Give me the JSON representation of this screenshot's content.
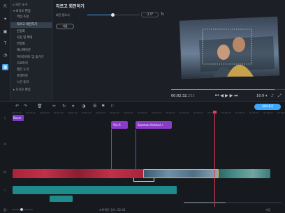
{
  "sidebar": {
    "icons": [
      "import-icon",
      "wand-icon",
      "filters-icon",
      "text-icon",
      "stickers-icon",
      "transitions-icon"
    ]
  },
  "panel": {
    "items": [
      {
        "label": "모든 도구",
        "level": 0
      },
      {
        "label": "▾ 비디오 편집",
        "level": 1
      },
      {
        "label": "색상 조정",
        "level": 2
      },
      {
        "label": "자르고 회전하기",
        "level": 2,
        "selected": true
      },
      {
        "label": "안정화",
        "level": 2
      },
      {
        "label": "자동 및 확대",
        "level": 2
      },
      {
        "label": "변형화",
        "level": 2
      },
      {
        "label": "애니메이션",
        "level": 2
      },
      {
        "label": "하이라이트 및 숨기기",
        "level": 2
      },
      {
        "label": "크로마키",
        "level": 2
      },
      {
        "label": "팬은 도리",
        "level": 2
      },
      {
        "label": "프레이밍",
        "level": 2
      },
      {
        "label": "느린 동작",
        "level": 2
      },
      {
        "label": "▸ 오디오 편집",
        "level": 1
      }
    ]
  },
  "tools": {
    "title": "자르고 회전하기",
    "angle_label": "회전 정도기",
    "angle_value": "-2.5°",
    "crop_button": "자름"
  },
  "preview": {
    "timecode": "00:02:32",
    "timecode_frac": ".253",
    "aspect": "16:9 ▾"
  },
  "timeline": {
    "export_button": "내보내기",
    "ruler": [
      "00:00:00",
      "00:00:20",
      "00:00:40",
      "00:01:00",
      "00:01:20",
      "00:01:40",
      "00:02:00",
      "00:02:20",
      "00:02:40",
      "00:03:00",
      "00:03:20",
      "00:03:40",
      "00:04:00",
      "00:04:20",
      "00:04:40",
      "00:05:00",
      "00:05:20",
      "00:05:40",
      "00:06:00",
      "00:06:20"
    ],
    "title_clip": "Boom",
    "text_clip_1": "텍스트",
    "text_clip_2": "Summer festival ♪",
    "project_length": "프로젝트 길이: 02:42",
    "zoom_label": "줌:",
    "save_label": "저장"
  }
}
